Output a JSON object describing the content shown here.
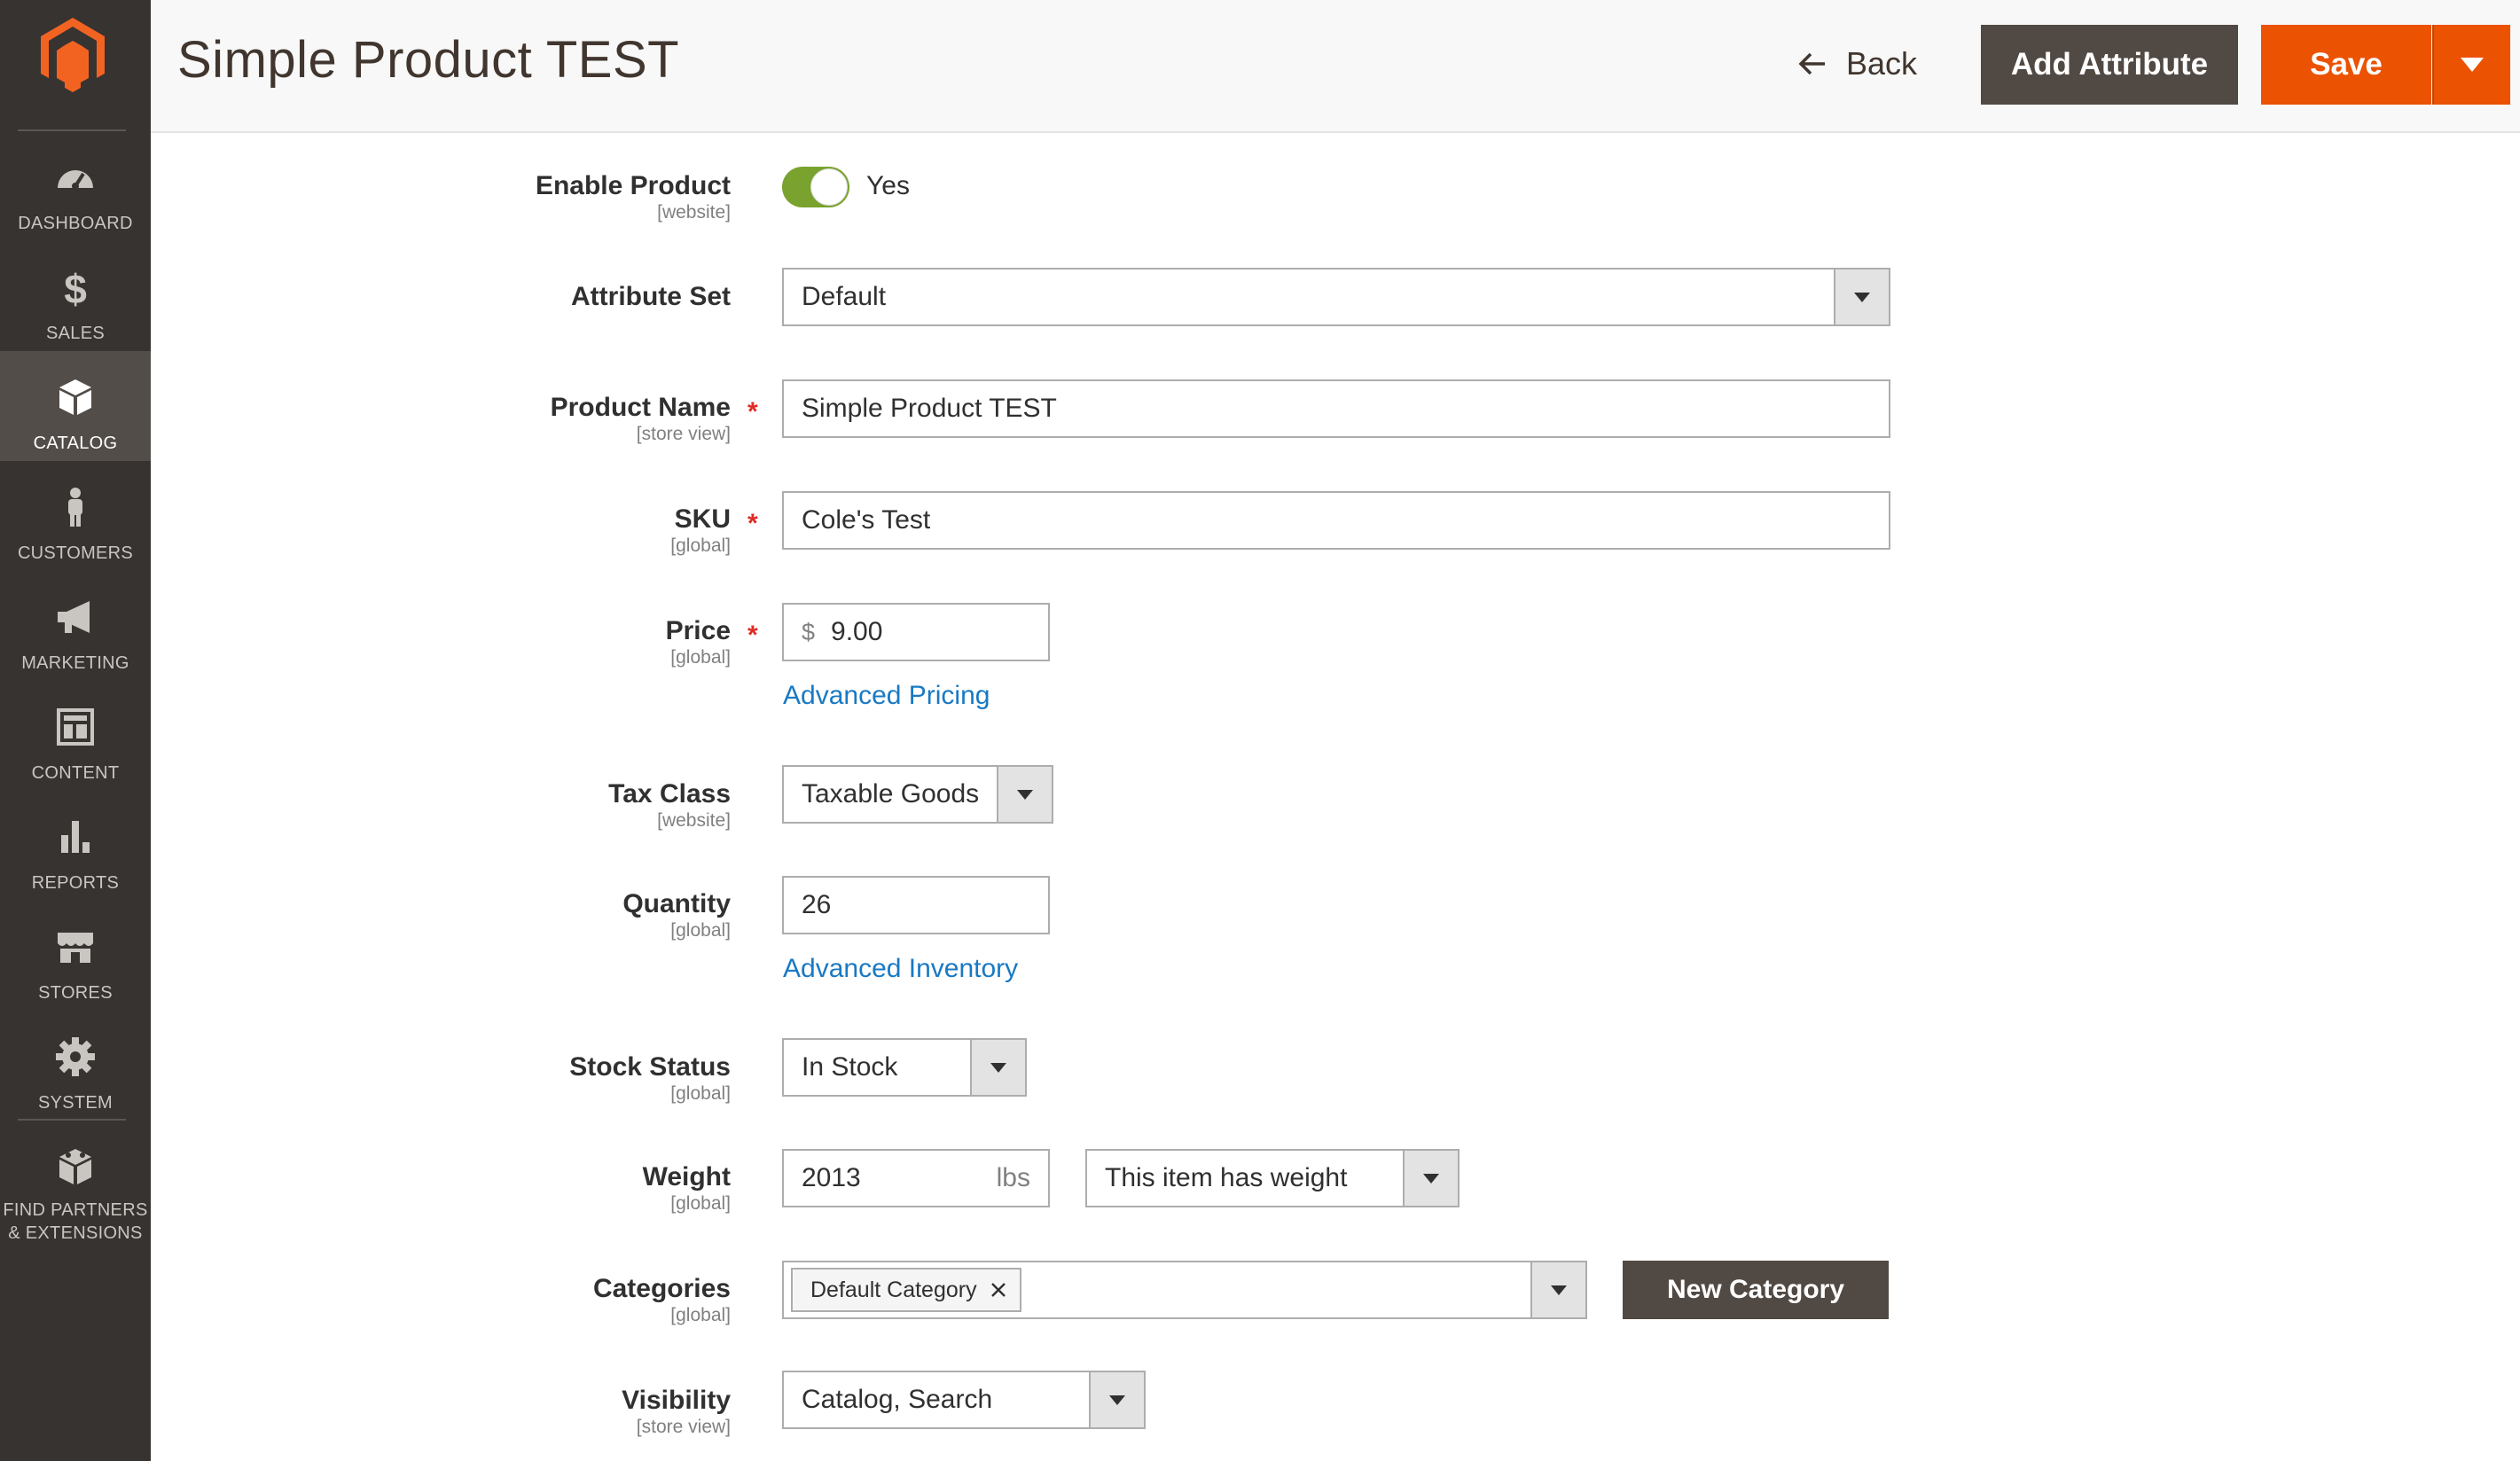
{
  "sidebar": {
    "items": [
      {
        "label": "DASHBOARD",
        "icon": "dashboard-icon"
      },
      {
        "label": "SALES",
        "icon": "dollar-icon"
      },
      {
        "label": "CATALOG",
        "icon": "catalog-box-icon",
        "active": true
      },
      {
        "label": "CUSTOMERS",
        "icon": "customer-person-icon"
      },
      {
        "label": "MARKETING",
        "icon": "megaphone-icon"
      },
      {
        "label": "CONTENT",
        "icon": "content-layout-icon"
      },
      {
        "label": "REPORTS",
        "icon": "bar-chart-icon"
      },
      {
        "label": "STORES",
        "icon": "storefront-icon"
      },
      {
        "label": "SYSTEM",
        "icon": "gear-icon"
      },
      {
        "label_line1": "FIND PARTNERS",
        "label_line2": "& EXTENSIONS",
        "icon": "extensions-blocks-icon"
      }
    ]
  },
  "header": {
    "title": "Simple Product TEST",
    "back_label": "Back",
    "add_attribute_label": "Add Attribute",
    "save_label": "Save"
  },
  "form": {
    "enable_product": {
      "label": "Enable Product",
      "scope": "[website]",
      "value": "Yes"
    },
    "attribute_set": {
      "label": "Attribute Set",
      "value": "Default"
    },
    "product_name": {
      "label": "Product Name",
      "scope": "[store view]",
      "value": "Simple Product TEST",
      "required": "*"
    },
    "sku": {
      "label": "SKU",
      "scope": "[global]",
      "value": "Cole's Test",
      "required": "*"
    },
    "price": {
      "label": "Price",
      "scope": "[global]",
      "currency": "$",
      "value": "9.00",
      "required": "*",
      "advanced_link": "Advanced Pricing"
    },
    "tax_class": {
      "label": "Tax Class",
      "scope": "[website]",
      "value": "Taxable Goods"
    },
    "quantity": {
      "label": "Quantity",
      "scope": "[global]",
      "value": "26",
      "advanced_link": "Advanced Inventory"
    },
    "stock_status": {
      "label": "Stock Status",
      "scope": "[global]",
      "value": "In Stock"
    },
    "weight": {
      "label": "Weight",
      "scope": "[global]",
      "value": "2013",
      "unit": "lbs",
      "has_weight": "This item has weight"
    },
    "categories": {
      "label": "Categories",
      "scope": "[global]",
      "chip": "Default Category",
      "new_category_label": "New Category"
    },
    "visibility": {
      "label": "Visibility",
      "scope": "[store view]",
      "value": "Catalog, Search"
    }
  },
  "colors": {
    "sidebar_bg": "#373330",
    "sidebar_active": "#524d49",
    "save_orange": "#eb5202",
    "dark_button": "#514943",
    "toggle_green": "#79a22e",
    "link_blue": "#1979c3",
    "required_red": "#e02b27"
  }
}
